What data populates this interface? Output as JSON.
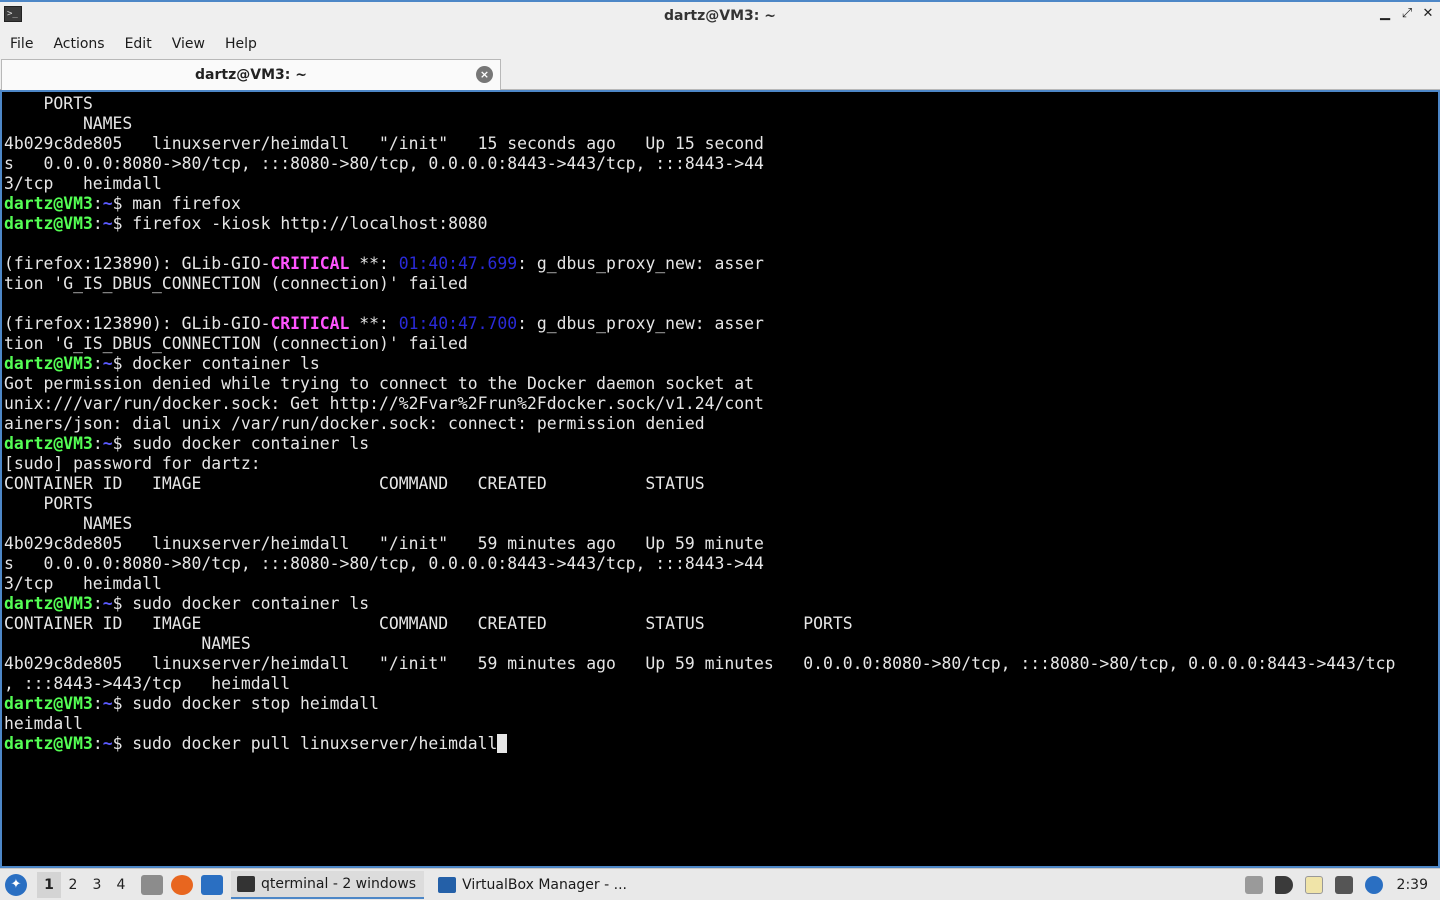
{
  "window": {
    "title": "dartz@VM3: ~",
    "controls": {
      "minimize": "▁",
      "maximize": "⤢",
      "close": "✕"
    }
  },
  "menu": [
    "File",
    "Actions",
    "Edit",
    "View",
    "Help"
  ],
  "tab": {
    "label": "dartz@VM3: ~",
    "close": "×"
  },
  "prompt": {
    "user": "dartz@VM3",
    "path": "~"
  },
  "terminal": {
    "lines": [
      [
        {
          "t": "    PORTS"
        }
      ],
      [
        {
          "t": "        NAMES"
        }
      ],
      [
        {
          "t": "4b029c8de805   linuxserver/heimdall   \"/init\"   15 seconds ago   Up 15 second"
        }
      ],
      [
        {
          "t": "s   0.0.0.0:8080->80/tcp, :::8080->80/tcp, 0.0.0.0:8443->443/tcp, :::8443->44"
        }
      ],
      [
        {
          "t": "3/tcp   heimdall"
        }
      ],
      [
        {
          "t": "dartz@VM3",
          "c": "prompt"
        },
        {
          "t": ":"
        },
        {
          "t": "~",
          "c": "tilde"
        },
        {
          "t": "$ man firefox"
        }
      ],
      [
        {
          "t": "dartz@VM3",
          "c": "prompt"
        },
        {
          "t": ":"
        },
        {
          "t": "~",
          "c": "tilde"
        },
        {
          "t": "$ firefox -kiosk http://localhost:8080"
        }
      ],
      [
        {
          "t": ""
        }
      ],
      [
        {
          "t": "(firefox:123890): GLib-GIO-"
        },
        {
          "t": "CRITICAL",
          "c": "crit"
        },
        {
          "t": " **: "
        },
        {
          "t": "01:40:47.699",
          "c": "ts"
        },
        {
          "t": ": g_dbus_proxy_new: asser"
        }
      ],
      [
        {
          "t": "tion 'G_IS_DBUS_CONNECTION (connection)' failed"
        }
      ],
      [
        {
          "t": ""
        }
      ],
      [
        {
          "t": "(firefox:123890): GLib-GIO-"
        },
        {
          "t": "CRITICAL",
          "c": "crit"
        },
        {
          "t": " **: "
        },
        {
          "t": "01:40:47.700",
          "c": "ts"
        },
        {
          "t": ": g_dbus_proxy_new: asser"
        }
      ],
      [
        {
          "t": "tion 'G_IS_DBUS_CONNECTION (connection)' failed"
        }
      ],
      [
        {
          "t": "dartz@VM3",
          "c": "prompt"
        },
        {
          "t": ":"
        },
        {
          "t": "~",
          "c": "tilde"
        },
        {
          "t": "$ docker container ls"
        }
      ],
      [
        {
          "t": "Got permission denied while trying to connect to the Docker daemon socket at"
        }
      ],
      [
        {
          "t": "unix:///var/run/docker.sock: Get http://%2Fvar%2Frun%2Fdocker.sock/v1.24/cont"
        }
      ],
      [
        {
          "t": "ainers/json: dial unix /var/run/docker.sock: connect: permission denied"
        }
      ],
      [
        {
          "t": "dartz@VM3",
          "c": "prompt"
        },
        {
          "t": ":"
        },
        {
          "t": "~",
          "c": "tilde"
        },
        {
          "t": "$ sudo docker container ls"
        }
      ],
      [
        {
          "t": "[sudo] password for dartz:"
        }
      ],
      [
        {
          "t": "CONTAINER ID   IMAGE                  COMMAND   CREATED          STATUS"
        }
      ],
      [
        {
          "t": "    PORTS"
        }
      ],
      [
        {
          "t": "        NAMES"
        }
      ],
      [
        {
          "t": "4b029c8de805   linuxserver/heimdall   \"/init\"   59 minutes ago   Up 59 minute"
        }
      ],
      [
        {
          "t": "s   0.0.0.0:8080->80/tcp, :::8080->80/tcp, 0.0.0.0:8443->443/tcp, :::8443->44"
        }
      ],
      [
        {
          "t": "3/tcp   heimdall"
        }
      ],
      [
        {
          "t": "dartz@VM3",
          "c": "prompt"
        },
        {
          "t": ":"
        },
        {
          "t": "~",
          "c": "tilde"
        },
        {
          "t": "$ sudo docker container ls"
        }
      ],
      [
        {
          "t": "CONTAINER ID   IMAGE                  COMMAND   CREATED          STATUS          PORTS"
        }
      ],
      [
        {
          "t": "                    NAMES"
        }
      ],
      [
        {
          "t": "4b029c8de805   linuxserver/heimdall   \"/init\"   59 minutes ago   Up 59 minutes   0.0.0.0:8080->80/tcp, :::8080->80/tcp, 0.0.0.0:8443->443/tcp"
        }
      ],
      [
        {
          "t": ", :::8443->443/tcp   heimdall"
        }
      ],
      [
        {
          "t": "dartz@VM3",
          "c": "prompt"
        },
        {
          "t": ":"
        },
        {
          "t": "~",
          "c": "tilde"
        },
        {
          "t": "$ sudo docker stop heimdall"
        }
      ],
      [
        {
          "t": "heimdall"
        }
      ],
      [
        {
          "t": "dartz@VM3",
          "c": "prompt"
        },
        {
          "t": ":"
        },
        {
          "t": "~",
          "c": "tilde"
        },
        {
          "t": "$ sudo docker pull linuxserver/heimdall"
        },
        {
          "t": "",
          "c": "cursor"
        }
      ]
    ]
  },
  "taskbar": {
    "menu_icon": "lxqt-menu-icon",
    "desktops": [
      "1",
      "2",
      "3",
      "4"
    ],
    "active_desktop": "1",
    "launchers": [
      "file-manager-icon",
      "firefox-icon",
      "desktop-icon"
    ],
    "tasks": [
      {
        "label": "qterminal - 2 windows",
        "icon": "terminal-icon",
        "active": true
      },
      {
        "label": "VirtualBox Manager - ...",
        "icon": "virtualbox-icon",
        "active": false
      }
    ],
    "tray": [
      "tray-eject-icon",
      "volume-icon",
      "clipboard-icon",
      "network-icon",
      "notification-icon"
    ],
    "clock": "2:39"
  },
  "colors": {
    "prompt": "#54ff54",
    "path": "#5a5aff",
    "critical": "#ff54ff",
    "timestamp": "#2a2ad8",
    "accent": "#4d87c7"
  }
}
